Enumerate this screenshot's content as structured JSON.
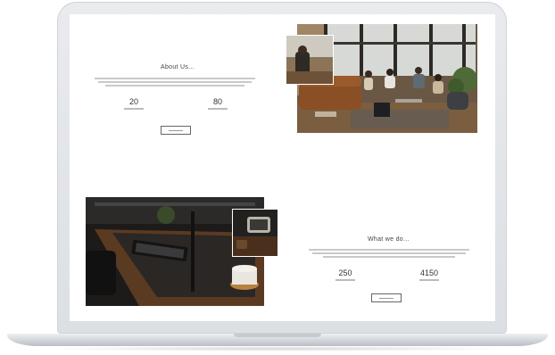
{
  "about": {
    "title": "About Us...",
    "stats": [
      {
        "value": "20"
      },
      {
        "value": "80"
      }
    ],
    "button": ""
  },
  "services": {
    "title": "What we do...",
    "stats": [
      {
        "value": "250"
      },
      {
        "value": "4150"
      }
    ],
    "button": ""
  },
  "colors": {
    "frame": "#e2e5e8",
    "screen_bg": "#ffffff",
    "title_text": "#444444"
  }
}
